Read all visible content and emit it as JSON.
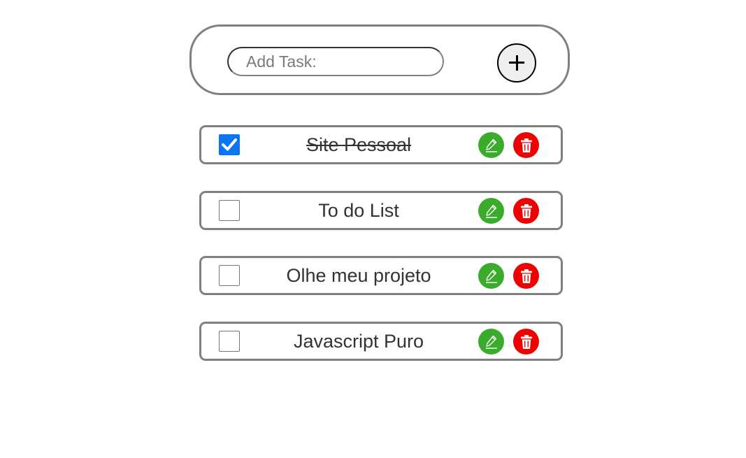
{
  "add_task": {
    "placeholder": "Add Task:",
    "add_button_label": "+"
  },
  "tasks": [
    {
      "label": "Site Pessoal",
      "checked": true
    },
    {
      "label": "To do List",
      "checked": false
    },
    {
      "label": "Olhe meu projeto",
      "checked": false
    },
    {
      "label": "Javascript Puro",
      "checked": false
    }
  ],
  "icons": {
    "add": "plus-icon",
    "edit": "pencil-icon",
    "delete": "trash-icon",
    "checked": "checkmark-icon"
  },
  "colors": {
    "edit_button": "#3aab2b",
    "delete_button": "#f00000",
    "checkbox_checked": "#0b75f4",
    "border": "#808080"
  }
}
